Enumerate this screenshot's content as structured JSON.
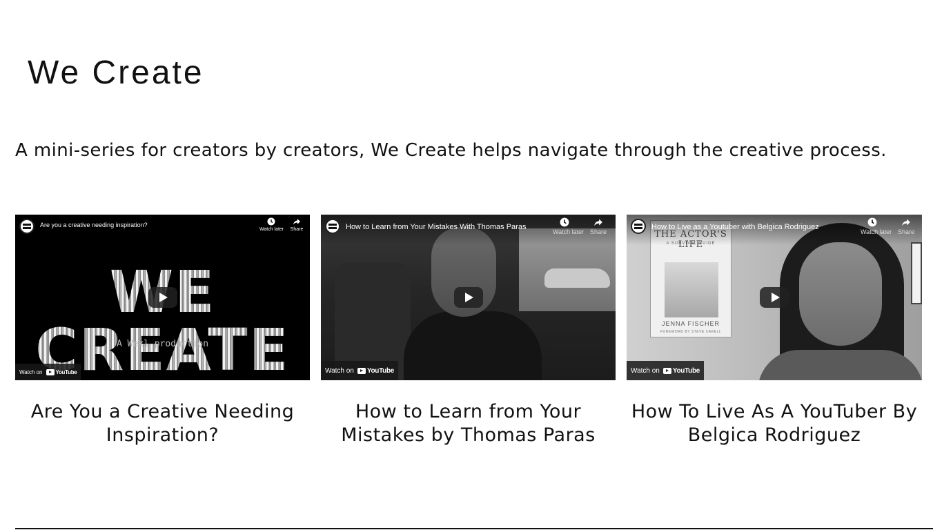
{
  "section": {
    "title": "We Create",
    "intro": "A mini-series for creators by creators, We Create helps navigate through the creative process."
  },
  "videos": [
    {
      "player_title": "Are you a creative needing inspiration?",
      "watch_later_label": "Watch later",
      "share_label": "Share",
      "watch_on_label": "Watch on",
      "youtube_label": "YouTube",
      "art_word": "WE CREATE",
      "art_subtitle": "A Wexl production",
      "caption": "Are You a Creative Needing Inspiration?"
    },
    {
      "player_title": "How to Learn from Your Mistakes With Thomas Paras",
      "watch_later_label": "Watch later",
      "share_label": "Share",
      "watch_on_label": "Watch on",
      "youtube_label": "YouTube",
      "caption": "How to Learn from Your Mistakes by Thomas Paras"
    },
    {
      "player_title": "How to Live as a Youtuber with Belgica Rodriguez",
      "watch_later_label": "Watch later",
      "share_label": "Share",
      "watch_on_label": "Watch on",
      "youtube_label": "YouTube",
      "poster_title": "THE ACTOR'S LIFE",
      "poster_subtitle": "A SURVIVAL GUIDE",
      "poster_author": "JENNA FISCHER",
      "poster_foreword": "FOREWORD BY STEVE CARELL",
      "caption": "How To Live As A YouTuber By Belgica Rodriguez"
    }
  ]
}
